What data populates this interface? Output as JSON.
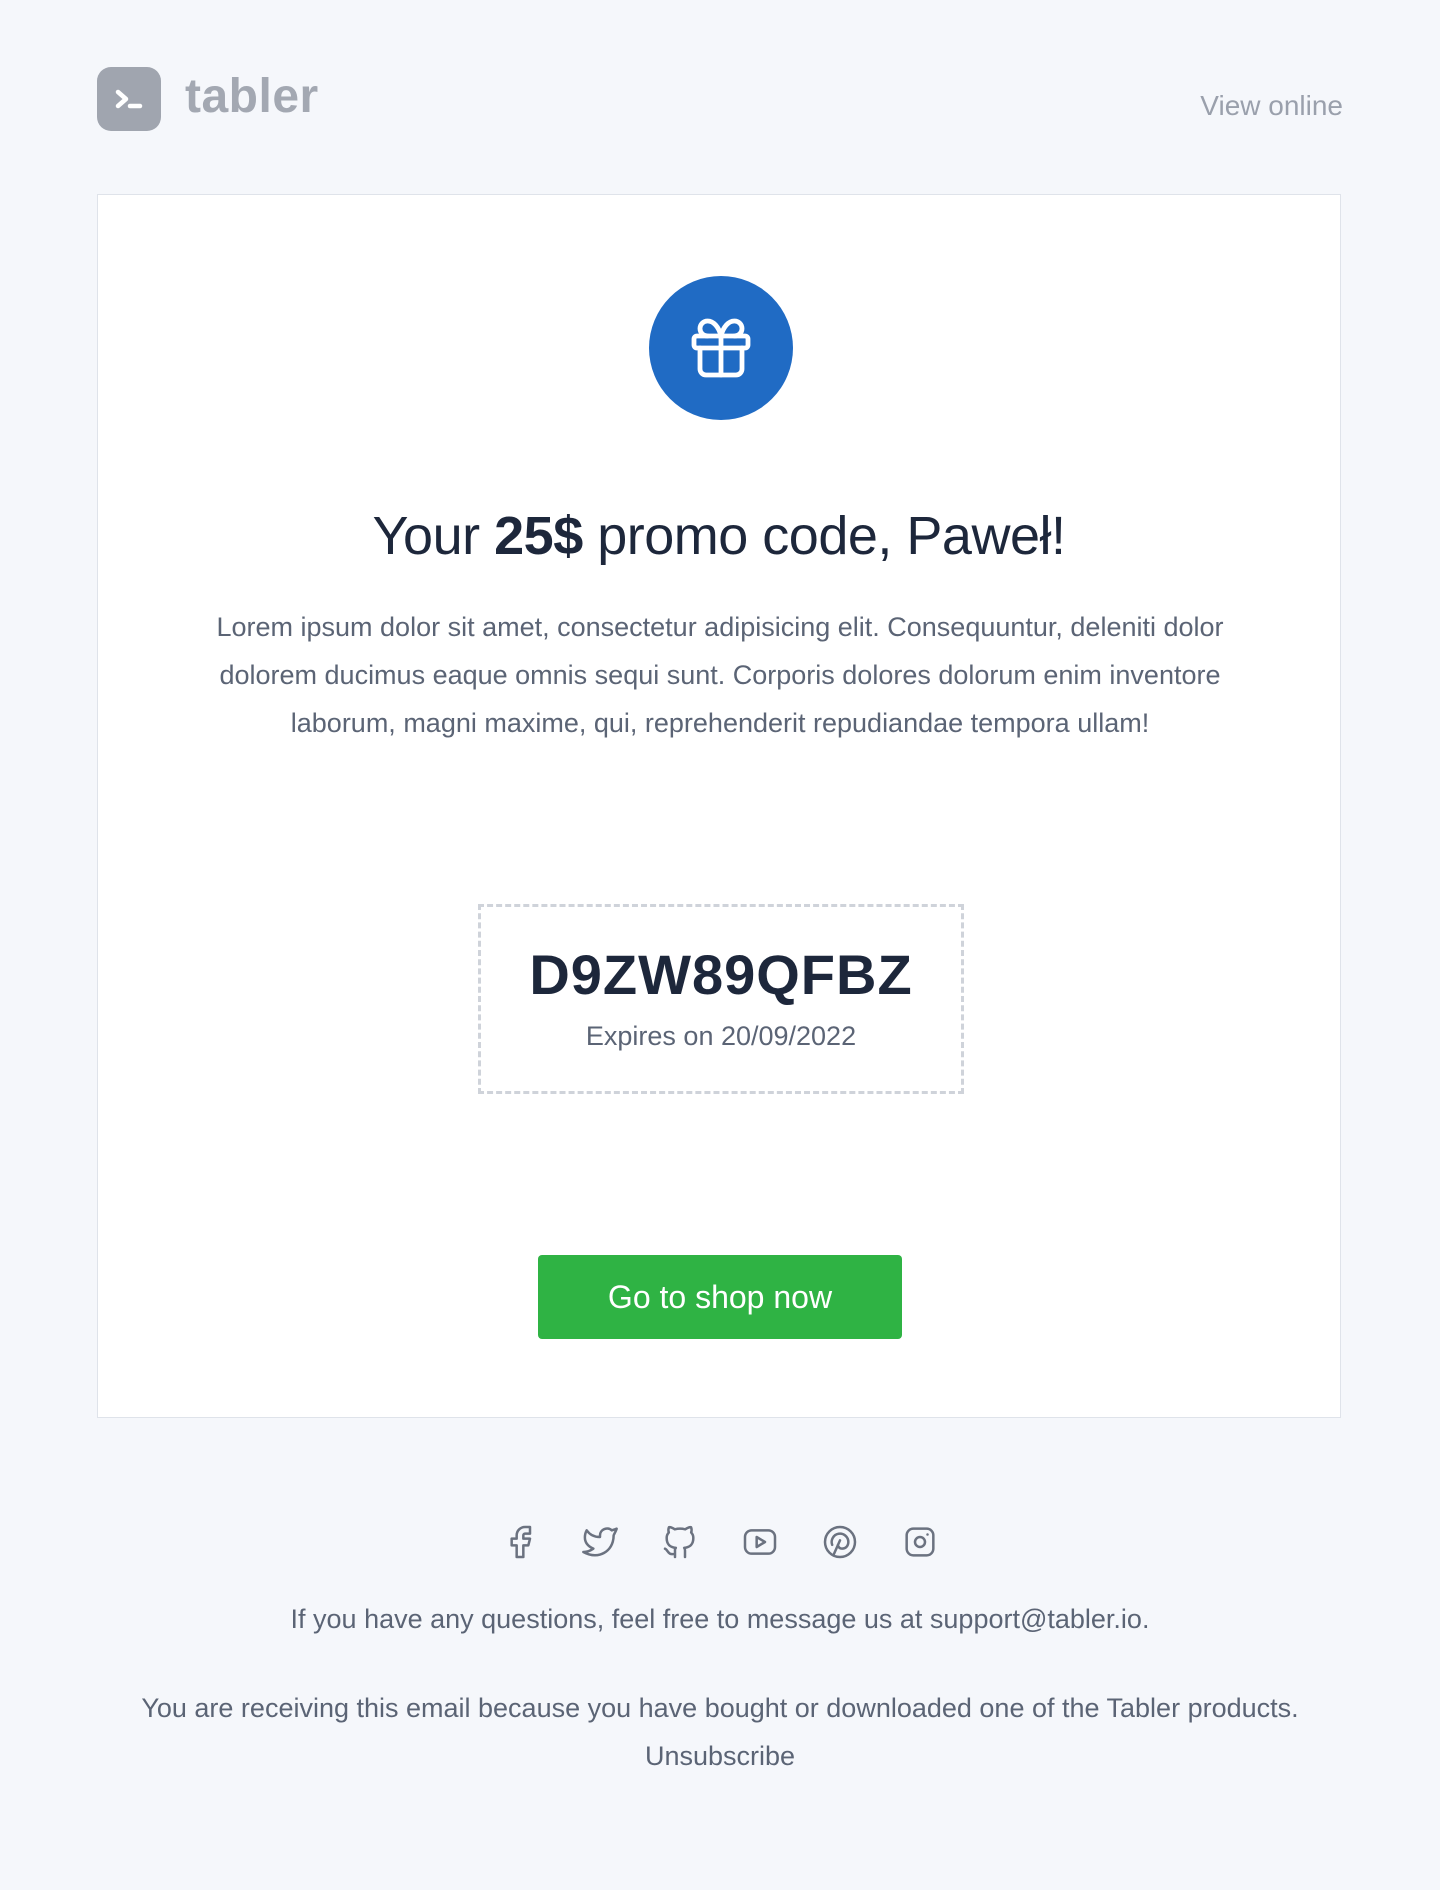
{
  "header": {
    "logo_text": "tabler",
    "view_online_label": "View online"
  },
  "card": {
    "icon": "gift-icon",
    "accent_color": "#206bc4",
    "headline_prefix": "Your ",
    "headline_amount": "25$",
    "headline_suffix": " promo code, Paweł!",
    "body": "Lorem ipsum dolor sit amet, consectetur adipisicing elit. Consequuntur, deleniti dolor dolorem ducimus eaque omnis sequi sunt. Corporis dolores dolorum enim inventore laborum, magni maxime, qui, reprehenderit repudiandae tempora ullam!",
    "promo_code": "D9ZW89QFBZ",
    "expiry": "Expires on 20/09/2022",
    "cta_label": "Go to shop now",
    "cta_color": "#2fb344"
  },
  "footer": {
    "socials": [
      "facebook-icon",
      "twitter-icon",
      "github-icon",
      "youtube-icon",
      "pinterest-icon",
      "instagram-icon"
    ],
    "question": "If you have any questions, feel free to message us at support@tabler.io.",
    "legal": "You are receiving this email because you have bought or downloaded one of the Tabler products.",
    "unsubscribe_label": "Unsubscribe"
  }
}
